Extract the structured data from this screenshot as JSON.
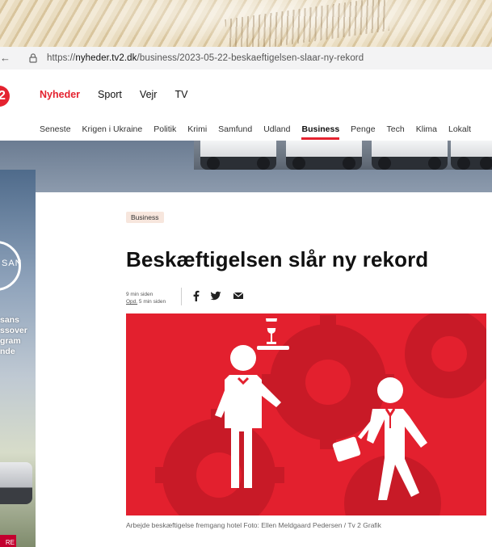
{
  "browser": {
    "url_prefix": "https://",
    "url_domain": "nyheder.tv2.dk",
    "url_path": "/business/2023-05-22-beskaeftigelsen-slaar-ny-rekord"
  },
  "site": {
    "logo_digit": "2",
    "main_nav": [
      "Nyheder",
      "Sport",
      "Vejr",
      "TV"
    ],
    "main_nav_active": "Nyheder",
    "sub_nav": [
      "Seneste",
      "Krigen i Ukraine",
      "Politik",
      "Krimi",
      "Samfund",
      "Udland",
      "Business",
      "Penge",
      "Tech",
      "Klima",
      "Lokalt"
    ],
    "sub_nav_active": "Business",
    "accent_color": "#e4222f"
  },
  "ad": {
    "brand_text": "SAN",
    "copy_lines": [
      "sans",
      "ssover",
      "gram",
      "nde"
    ],
    "cta": "RE"
  },
  "article": {
    "category": "Business",
    "headline": "Beskæftigelsen slår ny rekord",
    "published": "9 min siden",
    "updated_label": "Opd.",
    "updated": "5 min siden",
    "caption": "Arbejde beskæftigelse fremgang hotel Foto: Ellen Meldgaard Pedersen / Tv 2 Grafik",
    "hero_bg_color": "#e3202e"
  }
}
